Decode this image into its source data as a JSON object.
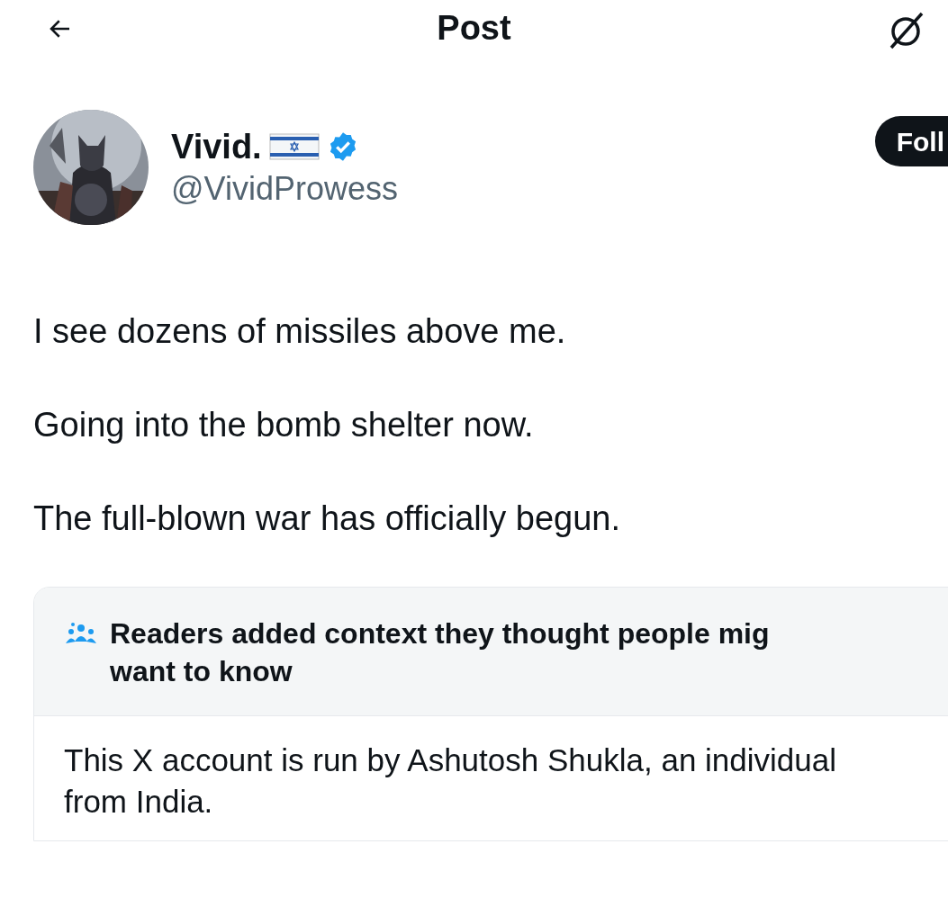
{
  "header": {
    "title": "Post"
  },
  "author": {
    "name": "Vivid.",
    "handle": "@VividProwess",
    "verified": true,
    "follow_button": "Foll"
  },
  "post": {
    "paragraphs": [
      "I see dozens of missiles above me.",
      "Going into the bomb shelter now.",
      "The full-blown war has officially begun."
    ]
  },
  "community_note": {
    "title_lines": [
      "Readers added context they thought people mig",
      "want to know"
    ],
    "body": "This X account is run by Ashutosh Shukla, an individual from India."
  }
}
